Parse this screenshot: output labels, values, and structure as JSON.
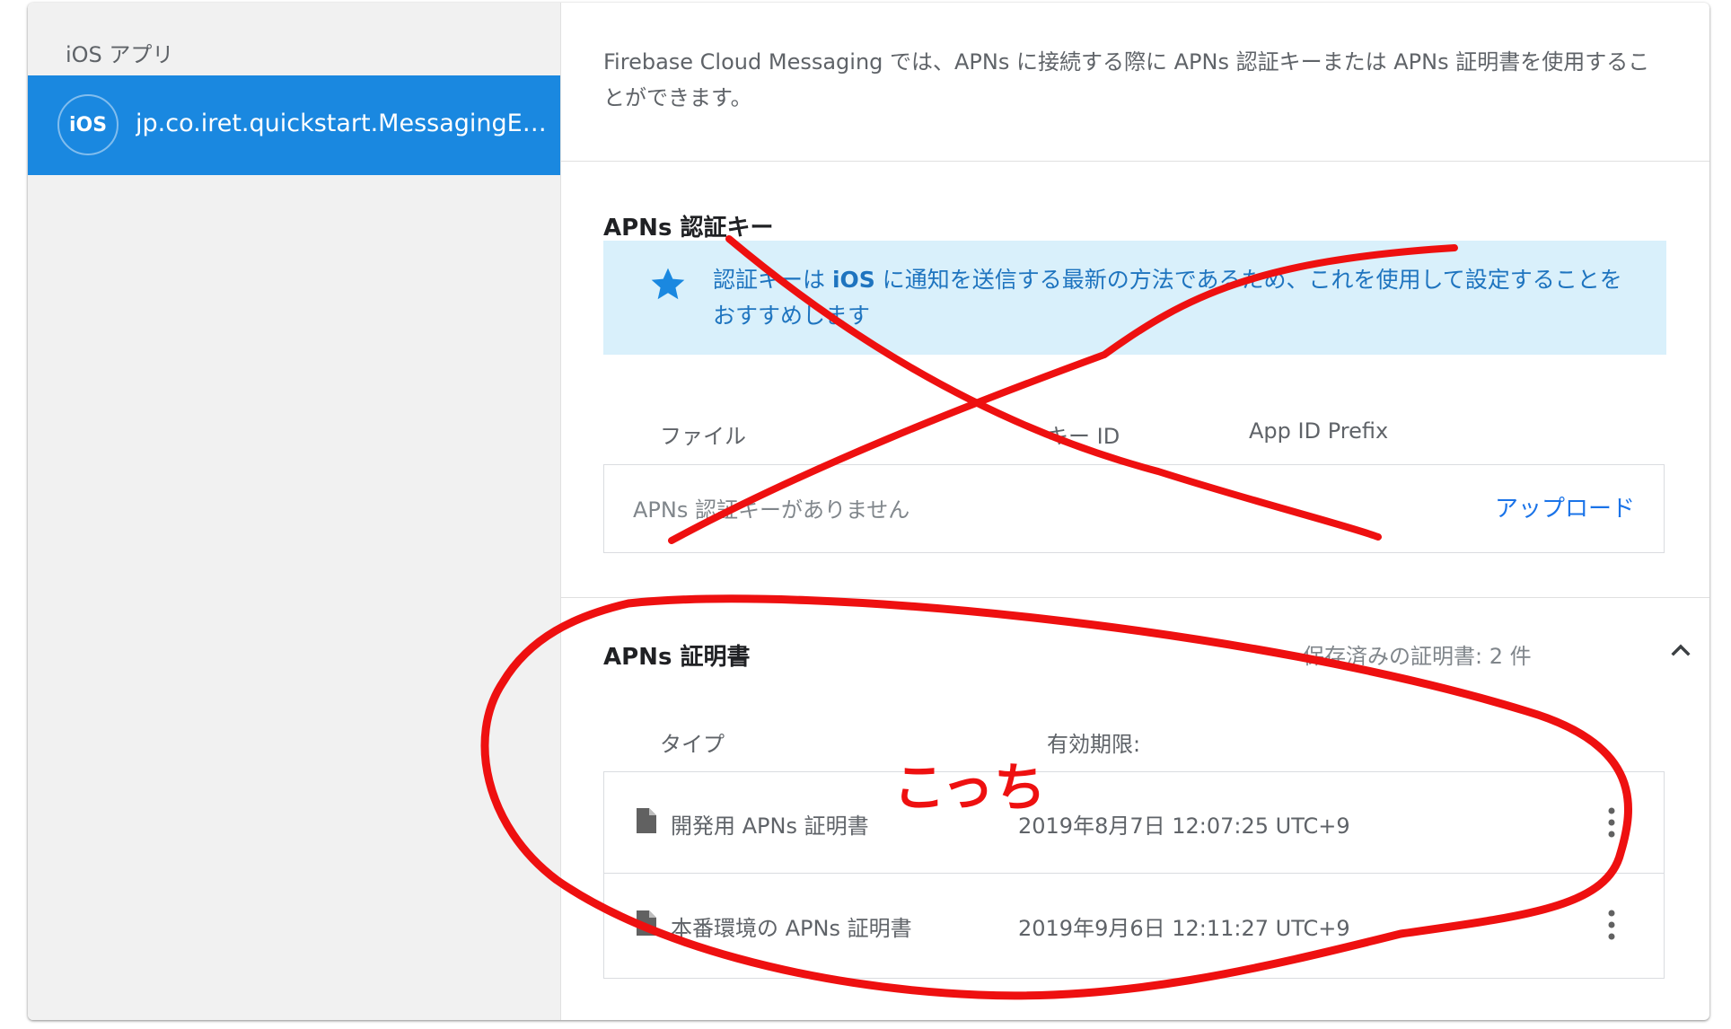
{
  "sidebar": {
    "heading": "iOS アプリ",
    "app": {
      "badge": "iOS",
      "name": "jp.co.iret.quickstart.MessagingExa..."
    }
  },
  "intro_text": "Firebase Cloud Messaging では、APNs に接続する際に APNs 認証キーまたは APNs 証明書を使用することができます。",
  "auth_key": {
    "title": "APNs 認証キー",
    "info_prefix": "認証キーは ",
    "info_bold": "iOS",
    "info_suffix": " に通知を送信する最新の方法であるため、これを使用して設定することをおすすめします",
    "columns": [
      "ファイル",
      "キー ID",
      "App ID Prefix"
    ],
    "empty_text": "APNs 認証キーがありません",
    "upload_label": "アップロード"
  },
  "certificates": {
    "title": "APNs 証明書",
    "saved_count": "保存済みの証明書: 2 件",
    "columns": [
      "タイプ",
      "有効期限:"
    ],
    "rows": [
      {
        "type": "開発用 APNs 証明書",
        "expiry": "2019年8月7日 12:07:25 UTC+9"
      },
      {
        "type": "本番環境の APNs 証明書",
        "expiry": "2019年9月6日 12:11:27 UTC+9"
      }
    ]
  },
  "annotation": {
    "label": "こっち",
    "color": "#ee1010"
  },
  "colors": {
    "accent": "#1a88e0",
    "info_bg": "#d9f0fb",
    "info_text": "#1e74bf",
    "link": "#1a73e8"
  }
}
